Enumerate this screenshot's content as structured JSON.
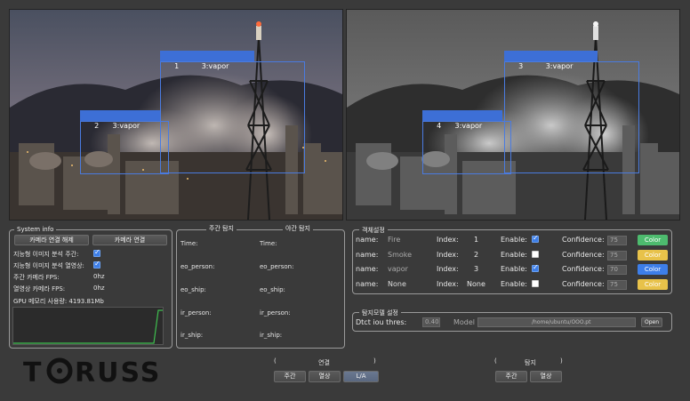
{
  "left_feed": {
    "detections": [
      {
        "id": "1",
        "label": "3:vapor"
      },
      {
        "id": "2",
        "label": "3:vapor"
      }
    ]
  },
  "right_feed": {
    "detections": [
      {
        "id": "3",
        "label": "3:vapor"
      },
      {
        "id": "4",
        "label": "3:vapor"
      }
    ]
  },
  "system_info": {
    "title": "System info",
    "btn_disconnect": "카메라 연결 해제",
    "btn_connect": "카메라 연결",
    "day_analysis_label": "지능형 이미지 분석 주간:",
    "thermal_analysis_label": "지능형 이미지 분석 열영상:",
    "day_fps_label": "주간 카메라 FPS:",
    "day_fps_value": "0hz",
    "thermal_fps_label": "열영상 카메라 FPS:",
    "thermal_fps_value": "0hz",
    "gpu_label": "GPU 메모리 사용량: 4193.81Mb"
  },
  "detect_counts": {
    "day_title": "주간 탐지",
    "night_title": "야간 탐지",
    "rows": [
      "Time:",
      "eo_person:",
      "eo_ship:",
      "ir_person:",
      "ir_ship:"
    ]
  },
  "object_settings": {
    "title": "객체설정",
    "name_label": "name:",
    "index_label": "Index:",
    "enable_label": "Enable:",
    "confidence_label": "Confidence:",
    "color_label": "Color",
    "rows": [
      {
        "name": "Fire",
        "index": "1",
        "enabled": true,
        "confidence": "75",
        "color": "#4dbb6e"
      },
      {
        "name": "Smoke",
        "index": "2",
        "enabled": false,
        "confidence": "75",
        "color": "#e8c24a"
      },
      {
        "name": "vapor",
        "index": "3",
        "enabled": true,
        "confidence": "70",
        "color": "#3d7ee8"
      },
      {
        "name": "None",
        "index": "None",
        "enabled": false,
        "confidence": "75",
        "color": "#e8c24a"
      }
    ]
  },
  "model_settings": {
    "title": "탐지모델 설정",
    "iou_label": "Dtct iou thres:",
    "iou_value": "0.40",
    "model_label": "Model",
    "model_path": "/home/ubuntu/OOO.pt",
    "open_label": "Open"
  },
  "logo": "TORUSS",
  "connection": {
    "title": "연결",
    "open_paren": "(",
    "close_paren": ")",
    "buttons": [
      "주간",
      "열상",
      "L/A"
    ]
  },
  "detection": {
    "title": "탐지",
    "open_paren": "(",
    "close_paren": ")",
    "buttons": [
      "주간",
      "열상"
    ]
  }
}
